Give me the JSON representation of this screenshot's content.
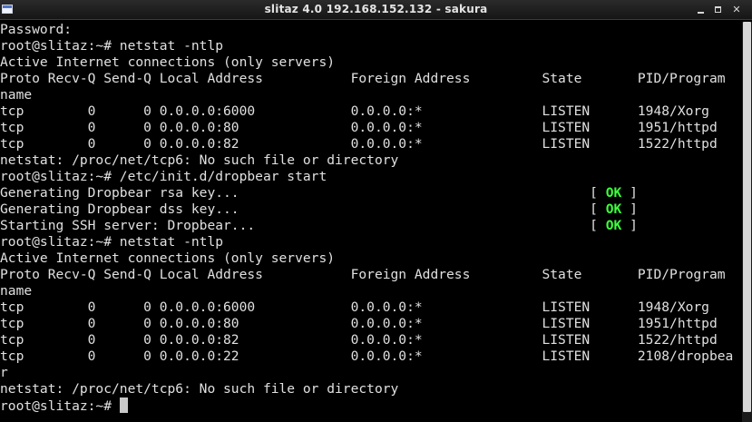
{
  "window": {
    "title": "slitaz 4.0 192.168.152.132 - sakura",
    "min_glyph": "",
    "max_glyph": "",
    "close_glyph": "✕"
  },
  "terminal": {
    "lines": [
      "Password:",
      "root@slitaz:~# netstat -ntlp",
      "Active Internet connections (only servers)",
      "Proto Recv-Q Send-Q Local Address           Foreign Address         State       PID/Program",
      "name",
      "tcp        0      0 0.0.0.0:6000            0.0.0.0:*               LISTEN      1948/Xorg",
      "tcp        0      0 0.0.0.0:80              0.0.0.0:*               LISTEN      1951/httpd",
      "tcp        0      0 0.0.0.0:82              0.0.0.0:*               LISTEN      1522/httpd",
      "netstat: /proc/net/tcp6: No such file or directory",
      "root@slitaz:~# /etc/init.d/dropbear start",
      "Generating Dropbear rsa key...                                            [ OK ]",
      "Generating Dropbear dss key...                                            [ OK ]",
      "Starting SSH server: Dropbear...                                          [ OK ]",
      "root@slitaz:~# netstat -ntlp",
      "Active Internet connections (only servers)",
      "Proto Recv-Q Send-Q Local Address           Foreign Address         State       PID/Program",
      "name",
      "tcp        0      0 0.0.0.0:6000            0.0.0.0:*               LISTEN      1948/Xorg",
      "tcp        0      0 0.0.0.0:80              0.0.0.0:*               LISTEN      1951/httpd",
      "tcp        0      0 0.0.0.0:82              0.0.0.0:*               LISTEN      1522/httpd",
      "tcp        0      0 0.0.0.0:22              0.0.0.0:*               LISTEN      2108/dropbea",
      "r",
      "netstat: /proc/net/tcp6: No such file or directory",
      "root@slitaz:~# "
    ],
    "ok_token": "OK"
  },
  "colors": {
    "background": "#000000",
    "foreground": "#e0e0e0",
    "ok_green": "#3cff3c"
  }
}
